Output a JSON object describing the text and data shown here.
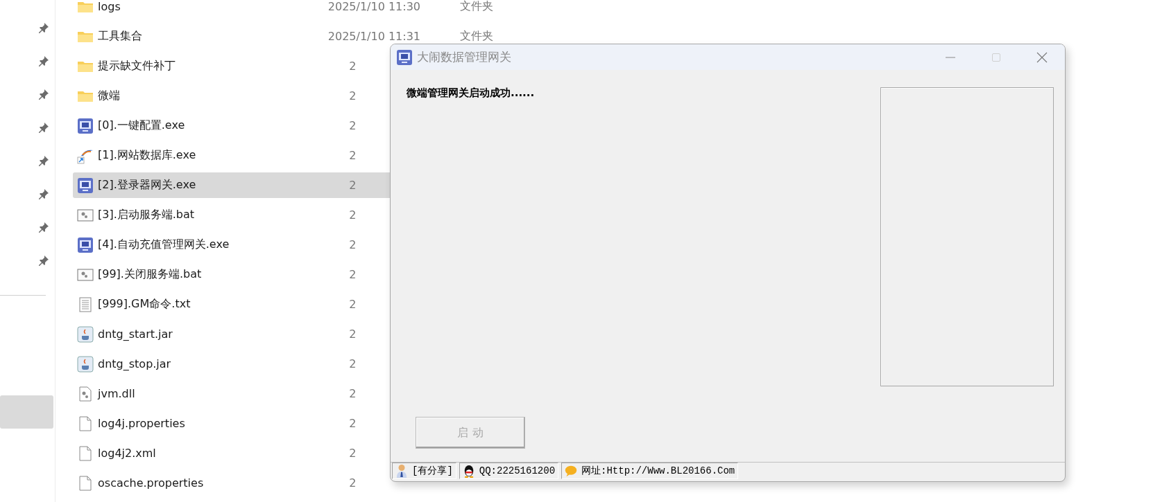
{
  "nav_items": [
    {
      "kind": "pin",
      "selected": false
    },
    {
      "kind": "pin",
      "selected": false
    },
    {
      "kind": "pin",
      "selected": false
    },
    {
      "kind": "pin",
      "selected": false
    },
    {
      "kind": "pin",
      "selected": false
    },
    {
      "kind": "pin",
      "selected": false
    },
    {
      "kind": "pin",
      "selected": false
    },
    {
      "kind": "pin",
      "selected": false
    },
    {
      "kind": "blank",
      "selected": true
    }
  ],
  "files": [
    {
      "kind": "folder",
      "name": "logs",
      "date": "2025/1/10 11:30",
      "type": "文件夹",
      "selected": false
    },
    {
      "kind": "folder",
      "name": "工具集合",
      "date": "2025/1/10 11:31",
      "type": "文件夹",
      "selected": false
    },
    {
      "kind": "folder",
      "name": "提示缺文件补丁",
      "date": "2",
      "selected": false
    },
    {
      "kind": "folder",
      "name": "微端",
      "date": "2",
      "selected": false
    },
    {
      "kind": "app",
      "name": "[0].一键配置.exe",
      "date": "2",
      "selected": false
    },
    {
      "kind": "shortcut",
      "name": "[1].网站数据库.exe",
      "date": "2",
      "selected": false
    },
    {
      "kind": "app",
      "name": "[2].登录器网关.exe",
      "date": "2",
      "selected": true
    },
    {
      "kind": "batch",
      "name": "[3].启动服务端.bat",
      "date": "2",
      "selected": false
    },
    {
      "kind": "app",
      "name": "[4].自动充值管理网关.exe",
      "date": "2",
      "selected": false
    },
    {
      "kind": "batch",
      "name": "[99].关闭服务端.bat",
      "date": "2",
      "selected": false
    },
    {
      "kind": "text",
      "name": "[999].GM命令.txt",
      "date": "2",
      "selected": false
    },
    {
      "kind": "java",
      "name": "dntg_start.jar",
      "date": "2",
      "selected": false
    },
    {
      "kind": "java",
      "name": "dntg_stop.jar",
      "date": "2",
      "selected": false
    },
    {
      "kind": "dll",
      "name": "jvm.dll",
      "date": "2",
      "selected": false
    },
    {
      "kind": "blank",
      "name": "log4j.properties",
      "date": "2",
      "selected": false
    },
    {
      "kind": "blank",
      "name": "log4j2.xml",
      "date": "2",
      "selected": false
    },
    {
      "kind": "blank",
      "name": "oscache.properties",
      "date": "2",
      "selected": false
    }
  ],
  "dialog": {
    "title": "大闹数据管理网关",
    "message": "微端管理网关启动成功......",
    "button": {
      "label": "启 动",
      "disabled": true
    },
    "status_bar": [
      {
        "kind": "user",
        "text": "[有分享]"
      },
      {
        "kind": "qq",
        "text": "QQ:2225161200"
      },
      {
        "kind": "chat",
        "text": "网址:Http://Www.BL20166.Com"
      }
    ]
  }
}
